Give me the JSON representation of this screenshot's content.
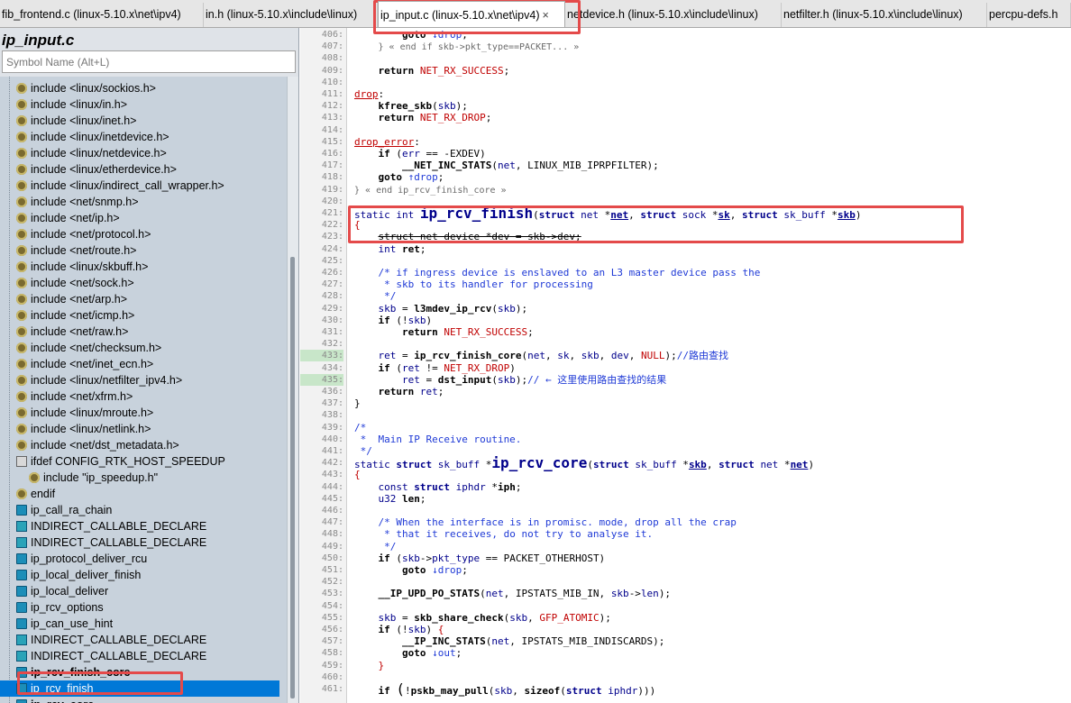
{
  "tabs": [
    {
      "label": "fib_frontend.c (linux-5.10.x\\net\\ipv4)",
      "active": false
    },
    {
      "label": "in.h (linux-5.10.x\\include\\linux)",
      "active": false
    },
    {
      "label": "ip_input.c (linux-5.10.x\\net\\ipv4)",
      "active": true,
      "close": "×"
    },
    {
      "label": "netdevice.h (linux-5.10.x\\include\\linux)",
      "active": false
    },
    {
      "label": "netfilter.h (linux-5.10.x\\include\\linux)",
      "active": false
    },
    {
      "label": "percpu-defs.h",
      "active": false
    }
  ],
  "sidebar": {
    "file_title": "ip_input.c",
    "search_placeholder": "Symbol Name (Alt+L)",
    "symbols": [
      {
        "label": "include <linux/sockios.h>",
        "icon": "include",
        "indent": 0
      },
      {
        "label": "include <linux/in.h>",
        "icon": "include",
        "indent": 0
      },
      {
        "label": "include <linux/inet.h>",
        "icon": "include",
        "indent": 0
      },
      {
        "label": "include <linux/inetdevice.h>",
        "icon": "include",
        "indent": 0
      },
      {
        "label": "include <linux/netdevice.h>",
        "icon": "include",
        "indent": 0
      },
      {
        "label": "include <linux/etherdevice.h>",
        "icon": "include",
        "indent": 0
      },
      {
        "label": "include <linux/indirect_call_wrapper.h>",
        "icon": "include",
        "indent": 0
      },
      {
        "label": "include <net/snmp.h>",
        "icon": "include",
        "indent": 0
      },
      {
        "label": "include <net/ip.h>",
        "icon": "include",
        "indent": 0
      },
      {
        "label": "include <net/protocol.h>",
        "icon": "include",
        "indent": 0
      },
      {
        "label": "include <net/route.h>",
        "icon": "include",
        "indent": 0
      },
      {
        "label": "include <linux/skbuff.h>",
        "icon": "include",
        "indent": 0
      },
      {
        "label": "include <net/sock.h>",
        "icon": "include",
        "indent": 0
      },
      {
        "label": "include <net/arp.h>",
        "icon": "include",
        "indent": 0
      },
      {
        "label": "include <net/icmp.h>",
        "icon": "include",
        "indent": 0
      },
      {
        "label": "include <net/raw.h>",
        "icon": "include",
        "indent": 0
      },
      {
        "label": "include <net/checksum.h>",
        "icon": "include",
        "indent": 0
      },
      {
        "label": "include <net/inet_ecn.h>",
        "icon": "include",
        "indent": 0
      },
      {
        "label": "include <linux/netfilter_ipv4.h>",
        "icon": "include",
        "indent": 0
      },
      {
        "label": "include <net/xfrm.h>",
        "icon": "include",
        "indent": 0
      },
      {
        "label": "include <linux/mroute.h>",
        "icon": "include",
        "indent": 0
      },
      {
        "label": "include <linux/netlink.h>",
        "icon": "include",
        "indent": 0
      },
      {
        "label": "include <net/dst_metadata.h>",
        "icon": "include",
        "indent": 0
      },
      {
        "label": "ifdef CONFIG_RTK_HOST_SPEEDUP",
        "icon": "ifdef",
        "indent": 0
      },
      {
        "label": "include \"ip_speedup.h\"",
        "icon": "include",
        "indent": 1
      },
      {
        "label": "endif",
        "icon": "endif",
        "indent": 0
      },
      {
        "label": "ip_call_ra_chain",
        "icon": "func",
        "indent": 0
      },
      {
        "label": "INDIRECT_CALLABLE_DECLARE",
        "icon": "macro",
        "indent": 0
      },
      {
        "label": "INDIRECT_CALLABLE_DECLARE",
        "icon": "macro",
        "indent": 0
      },
      {
        "label": "ip_protocol_deliver_rcu",
        "icon": "func",
        "indent": 0
      },
      {
        "label": "ip_local_deliver_finish",
        "icon": "func",
        "indent": 0
      },
      {
        "label": "ip_local_deliver",
        "icon": "func",
        "indent": 0
      },
      {
        "label": "ip_rcv_options",
        "icon": "func",
        "indent": 0
      },
      {
        "label": "ip_can_use_hint",
        "icon": "func",
        "indent": 0
      },
      {
        "label": "INDIRECT_CALLABLE_DECLARE",
        "icon": "macro",
        "indent": 0
      },
      {
        "label": "INDIRECT_CALLABLE_DECLARE",
        "icon": "macro",
        "indent": 0
      },
      {
        "label": "ip_rcv_finish_core",
        "icon": "func",
        "indent": 0,
        "bold": true
      },
      {
        "label": "ip_rcv_finish",
        "icon": "func",
        "indent": 0,
        "selected": true
      },
      {
        "label": "ip_rcv_core",
        "icon": "func",
        "indent": 0,
        "bold": true
      }
    ]
  },
  "code": {
    "lines": [
      {
        "n": "406:",
        "html": "        <span class=\"fn\">goto</span> <span class=\"cm\">↓drop</span>;"
      },
      {
        "n": "407:",
        "html": "    <span class=\"gy\">} « end if skb-&gt;pkt_type==PACKET... »</span>"
      },
      {
        "n": "408:",
        "html": ""
      },
      {
        "n": "409:",
        "html": "    <span class=\"fn\">return</span> <span class=\"mc\">NET_RX_SUCCESS</span>;"
      },
      {
        "n": "410:",
        "html": ""
      },
      {
        "n": "411:",
        "html": "<span class=\"lb\">drop</span>:"
      },
      {
        "n": "412:",
        "html": "    <span class=\"fn\">kfree_skb</span>(<span class=\"kw\">skb</span>);"
      },
      {
        "n": "413:",
        "html": "    <span class=\"fn\">return</span> <span class=\"mc\">NET_RX_DROP</span>;"
      },
      {
        "n": "414:",
        "html": ""
      },
      {
        "n": "415:",
        "html": "<span class=\"lb\">drop_error</span>:"
      },
      {
        "n": "416:",
        "html": "    <span class=\"fn\">if</span> (<span class=\"kw\">err</span> == -EXDEV)"
      },
      {
        "n": "417:",
        "html": "        <span class=\"fn\">__NET_INC_STATS</span>(<span class=\"kw\">net</span>, LINUX_MIB_IPRPFILTER);"
      },
      {
        "n": "418:",
        "html": "    <span class=\"fn\">goto</span> <span class=\"cm\">↑drop</span>;"
      },
      {
        "n": "419:",
        "html": "<span class=\"gy\">} « end ip_rcv_finish_core »</span>"
      },
      {
        "n": "420:",
        "html": ""
      },
      {
        "n": "421:",
        "html": "<span class=\"kw\">static int</span> <span class=\"fnd big\">ip_rcv_finish</span>(<span class=\"kwb\">struct</span> <span class=\"kw\">net</span> *<span class=\"pu\">net</span>, <span class=\"kwb\">struct</span> <span class=\"kw\">sock</span> *<span class=\"pu\">sk</span>, <span class=\"kwb\">struct</span> <span class=\"kw\">sk_buff</span> *<span class=\"pu\">skb</span>)"
      },
      {
        "n": "422:",
        "html": "<span class=\"mc\">{</span>"
      },
      {
        "n": "423:",
        "html": "    <span class=\"strike\">struct net_device *dev = skb->dev;</span>"
      },
      {
        "n": "424:",
        "html": "    <span class=\"kw\">int</span> <span class=\"fn\">ret</span>;"
      },
      {
        "n": "425:",
        "html": ""
      },
      {
        "n": "426:",
        "html": "    <span class=\"cmz\">/* if ingress device is enslaved to an L3 master device pass the</span>"
      },
      {
        "n": "427:",
        "html": "    <span class=\"cmz\"> * skb to its handler for processing</span>"
      },
      {
        "n": "428:",
        "html": "    <span class=\"cmz\"> */</span>"
      },
      {
        "n": "429:",
        "html": "    <span class=\"kw\">skb</span> = <span class=\"fn\">l3mdev_ip_rcv</span>(<span class=\"kw\">skb</span>);"
      },
      {
        "n": "430:",
        "html": "    <span class=\"fn\">if</span> (!<span class=\"kw\">skb</span>)"
      },
      {
        "n": "431:",
        "html": "        <span class=\"fn\">return</span> <span class=\"mc\">NET_RX_SUCCESS</span>;"
      },
      {
        "n": "432:",
        "html": ""
      },
      {
        "n": "433:",
        "html": "    <span class=\"kw\">ret</span> = <span class=\"fn\">ip_rcv_finish_core</span>(<span class=\"kw\">net</span>, <span class=\"kw\">sk</span>, <span class=\"kw\">skb</span>, <span class=\"kw\">dev</span>, <span class=\"mc\">NULL</span>);<span class=\"cmz\">//路由查找</span>",
        "changed": true
      },
      {
        "n": "434:",
        "html": "    <span class=\"fn\">if</span> (<span class=\"kw\">ret</span> != <span class=\"mc\">NET_RX_DROP</span>)"
      },
      {
        "n": "435:",
        "html": "        <span class=\"kw\">ret</span> = <span class=\"fn\">dst_input</span>(<span class=\"kw\">skb</span>);<span class=\"cmz\">// ← 这里使用路由查找的结果</span>",
        "changed": true
      },
      {
        "n": "436:",
        "html": "    <span class=\"fn\">return</span> <span class=\"kw\">ret</span>;"
      },
      {
        "n": "437:",
        "html": "}"
      },
      {
        "n": "438:",
        "html": ""
      },
      {
        "n": "439:",
        "html": "<span class=\"cmz\">/*</span>"
      },
      {
        "n": "440:",
        "html": "<span class=\"cmz\"> *  Main IP Receive routine.</span>"
      },
      {
        "n": "441:",
        "html": "<span class=\"cmz\"> */</span>"
      },
      {
        "n": "442:",
        "html": "<span class=\"kw\">static</span> <span class=\"kwb\">struct</span> <span class=\"kw\">sk_buff</span> *<span class=\"fnd big\">ip_rcv_core</span>(<span class=\"kwb\">struct</span> <span class=\"kw\">sk_buff</span> *<span class=\"pu\">skb</span>, <span class=\"kwb\">struct</span> <span class=\"kw\">net</span> *<span class=\"pu\">net</span>)"
      },
      {
        "n": "443:",
        "html": "<span class=\"mc\">{</span>"
      },
      {
        "n": "444:",
        "html": "    <span class=\"kw\">const</span> <span class=\"kwb\">struct</span> <span class=\"kw\">iphdr</span> *<span class=\"fn\">iph</span>;"
      },
      {
        "n": "445:",
        "html": "    <span class=\"kw\">u32</span> <span class=\"fn\">len</span>;"
      },
      {
        "n": "446:",
        "html": ""
      },
      {
        "n": "447:",
        "html": "    <span class=\"cmz\">/* When the interface is in promisc. mode, drop all the crap</span>"
      },
      {
        "n": "448:",
        "html": "    <span class=\"cmz\"> * that it receives, do not try to analyse it.</span>"
      },
      {
        "n": "449:",
        "html": "    <span class=\"cmz\"> */</span>"
      },
      {
        "n": "450:",
        "html": "    <span class=\"fn\">if</span> (<span class=\"kw\">skb</span>-&gt;<span class=\"kw\">pkt_type</span> == PACKET_OTHERHOST)"
      },
      {
        "n": "451:",
        "html": "        <span class=\"fn\">goto</span> <span class=\"cm\">↓drop</span>;"
      },
      {
        "n": "452:",
        "html": ""
      },
      {
        "n": "453:",
        "html": "    <span class=\"fn\">__IP_UPD_PO_STATS</span>(<span class=\"kw\">net</span>, IPSTATS_MIB_IN, <span class=\"kw\">skb</span>-&gt;<span class=\"kw\">len</span>);"
      },
      {
        "n": "454:",
        "html": ""
      },
      {
        "n": "455:",
        "html": "    <span class=\"kw\">skb</span> = <span class=\"fn\">skb_share_check</span>(<span class=\"kw\">skb</span>, <span class=\"mc\">GFP_ATOMIC</span>);"
      },
      {
        "n": "456:",
        "html": "    <span class=\"fn\">if</span> (!<span class=\"kw\">skb</span>) <span class=\"mc\">{</span>"
      },
      {
        "n": "457:",
        "html": "        <span class=\"fn\">__IP_INC_STATS</span>(<span class=\"kw\">net</span>, IPSTATS_MIB_INDISCARDS);"
      },
      {
        "n": "458:",
        "html": "        <span class=\"fn\">goto</span> <span class=\"cm\">↓out</span>;"
      },
      {
        "n": "459:",
        "html": "    <span class=\"mc\">}</span>"
      },
      {
        "n": "460:",
        "html": ""
      },
      {
        "n": "461:",
        "html": "    <span class=\"fn\">if</span> <span class=\"big\">(</span>!<span class=\"fn\">pskb_may_pull</span>(<span class=\"kw\">skb</span>, <span class=\"fn\">sizeof</span>(<span class=\"kwb\">struct</span> <span class=\"kw\">iphdr</span>)))"
      }
    ]
  },
  "colors": {
    "highlight_box": "#e44a4a",
    "selection": "#0078d7"
  }
}
